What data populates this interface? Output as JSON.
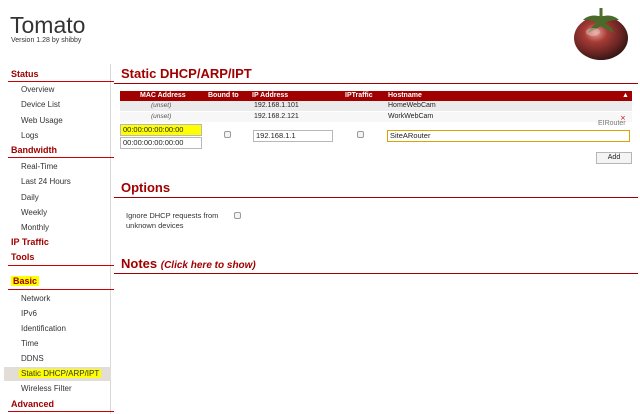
{
  "header": {
    "title": "Tomato",
    "version": "Version 1.28 by shibby"
  },
  "sidebar": {
    "status": "Status",
    "overview": "Overview",
    "device_list": "Device List",
    "web_usage": "Web Usage",
    "logs": "Logs",
    "bandwidth": "Bandwidth",
    "real_time": "Real-Time",
    "last_24_hours": "Last 24 Hours",
    "daily": "Daily",
    "weekly": "Weekly",
    "monthly": "Monthly",
    "ip_traffic": "IP Traffic",
    "tools": "Tools",
    "basic": "Basic",
    "network": "Network",
    "ipv6": "IPv6",
    "identification": "Identification",
    "time": "Time",
    "ddns": "DDNS",
    "static_dhcp": "Static DHCP/ARP/IPT",
    "wireless_filter": "Wireless Filter",
    "advanced": "Advanced"
  },
  "main": {
    "title": "Static DHCP/ARP/IPT",
    "router_name": "EIRouter",
    "table": {
      "headers": {
        "mac": "MAC Address",
        "bound": "Bound to",
        "ip": "IP Address",
        "iptraffic": "IPTraffic",
        "hostname": "Hostname",
        "sort_arrow": "▲"
      },
      "rows": [
        {
          "mac": "(unset)",
          "ip": "192.168.1.101",
          "hostname": "HomeWebCam"
        },
        {
          "mac": "(unset)",
          "ip": "192.168.2.121",
          "hostname": "WorkWebCam"
        }
      ],
      "delete_symbol": "×",
      "new_entry": {
        "mac1": "00:00:00:00:00:00",
        "mac2": "00:00:00:00:00:00",
        "ip": "192.168.1.1",
        "hostname": "SiteARouter"
      },
      "add_label": "Add"
    },
    "options": {
      "title": "Options",
      "ignore_label": "Ignore DHCP requests from unknown devices"
    },
    "notes": {
      "title": "Notes",
      "show_link": "(Click here to show)"
    }
  },
  "colors": {
    "accent": "#a00000",
    "highlight": "#ffff00"
  }
}
